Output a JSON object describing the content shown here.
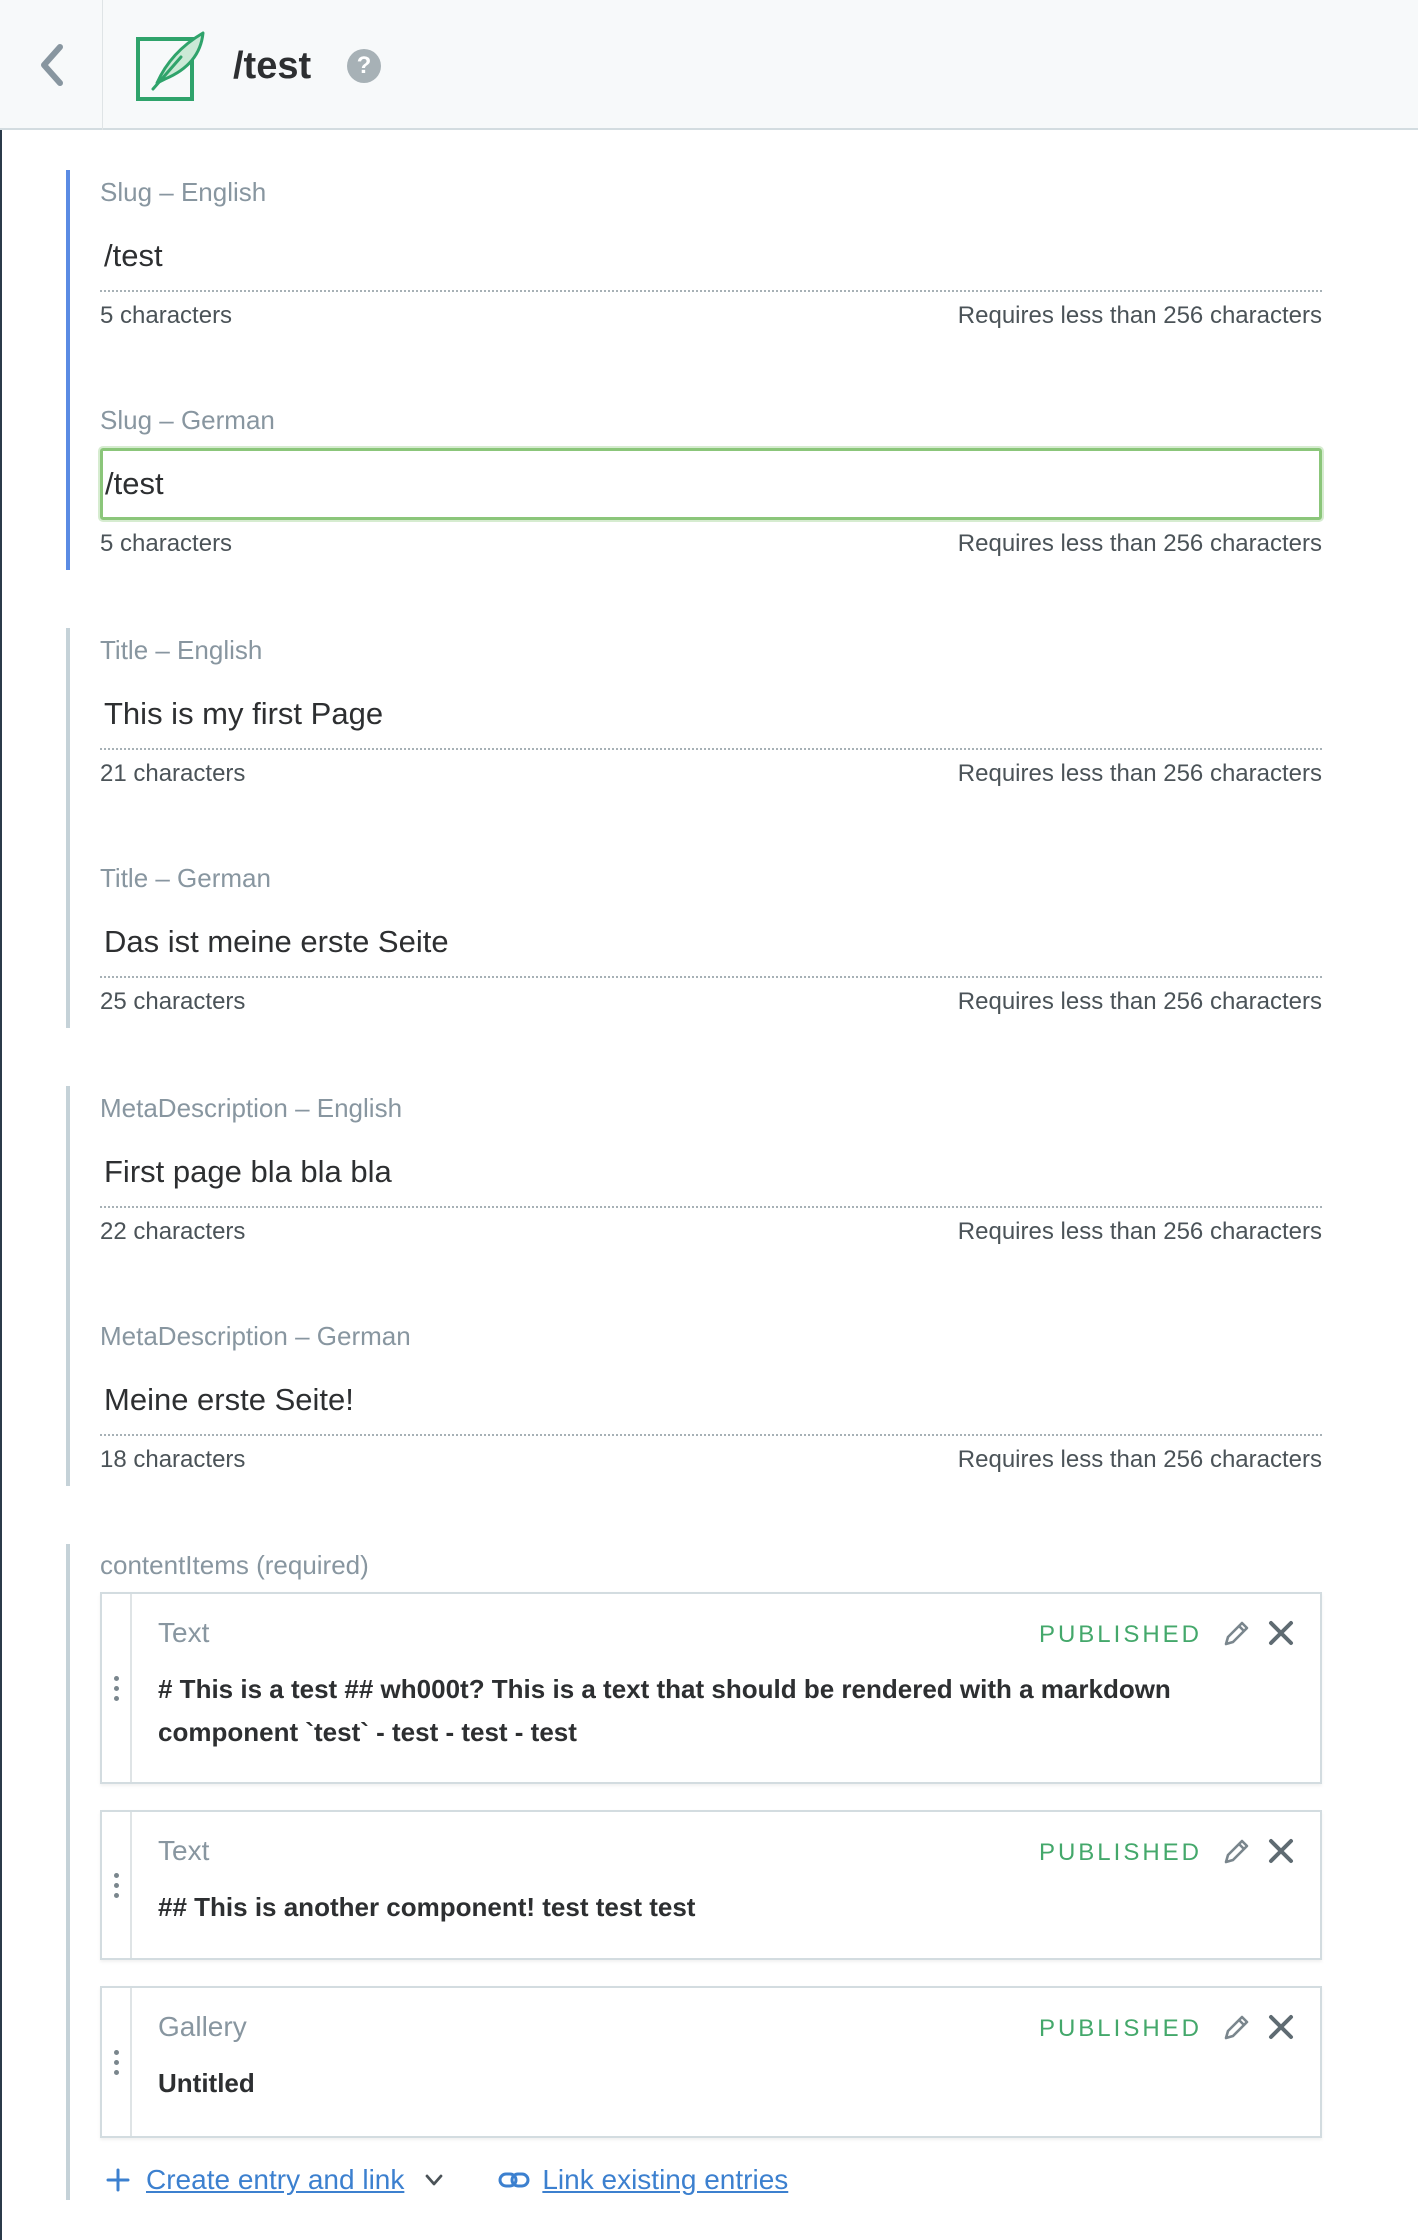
{
  "header": {
    "title": "/test",
    "help_glyph": "?",
    "icons": {
      "back": "chevron-left-icon",
      "entry": "feather-page-icon",
      "help": "question-circle-icon"
    },
    "accent": "#2fa36b"
  },
  "fields": [
    {
      "label": "Slug – English",
      "value": "/test",
      "count": "5 characters",
      "limit": "Requires less than 256 characters"
    },
    {
      "label": "Slug – German",
      "value": "/test",
      "count": "5 characters",
      "limit": "Requires less than 256 characters",
      "focused": true
    },
    {
      "label": "Title – English",
      "value": "This is my first Page",
      "count": "21 characters",
      "limit": "Requires less than 256 characters"
    },
    {
      "label": "Title – German",
      "value": "Das ist meine erste Seite",
      "count": "25 characters",
      "limit": "Requires less than 256 characters"
    },
    {
      "label": "MetaDescription – English",
      "value": "First page bla bla bla",
      "count": "22 characters",
      "limit": "Requires less than 256 characters"
    },
    {
      "label": "MetaDescription – German",
      "value": "Meine erste Seite!",
      "count": "18 characters",
      "limit": "Requires less than 256 characters"
    }
  ],
  "content_items": {
    "label": "contentItems (required)",
    "entries": [
      {
        "type": "Text",
        "status": "PUBLISHED",
        "line1": "# This is a test ## wh000t? This is a text that should be rendered with a markdown",
        "line2": "component `test` - test - test - test"
      },
      {
        "type": "Text",
        "status": "PUBLISHED",
        "line1": "## This is another component! test test test",
        "line2": ""
      },
      {
        "type": "Gallery",
        "status": "PUBLISHED",
        "line1": "Untitled",
        "line2": ""
      }
    ],
    "actions": {
      "create": "Create entry and link",
      "link": "Link existing entries"
    }
  },
  "colors": {
    "active_group": "#5b8be3",
    "idle_group": "#c5d2d8",
    "published": "#44a86b",
    "link": "#3c80cf",
    "focus": "#8bc67a"
  }
}
